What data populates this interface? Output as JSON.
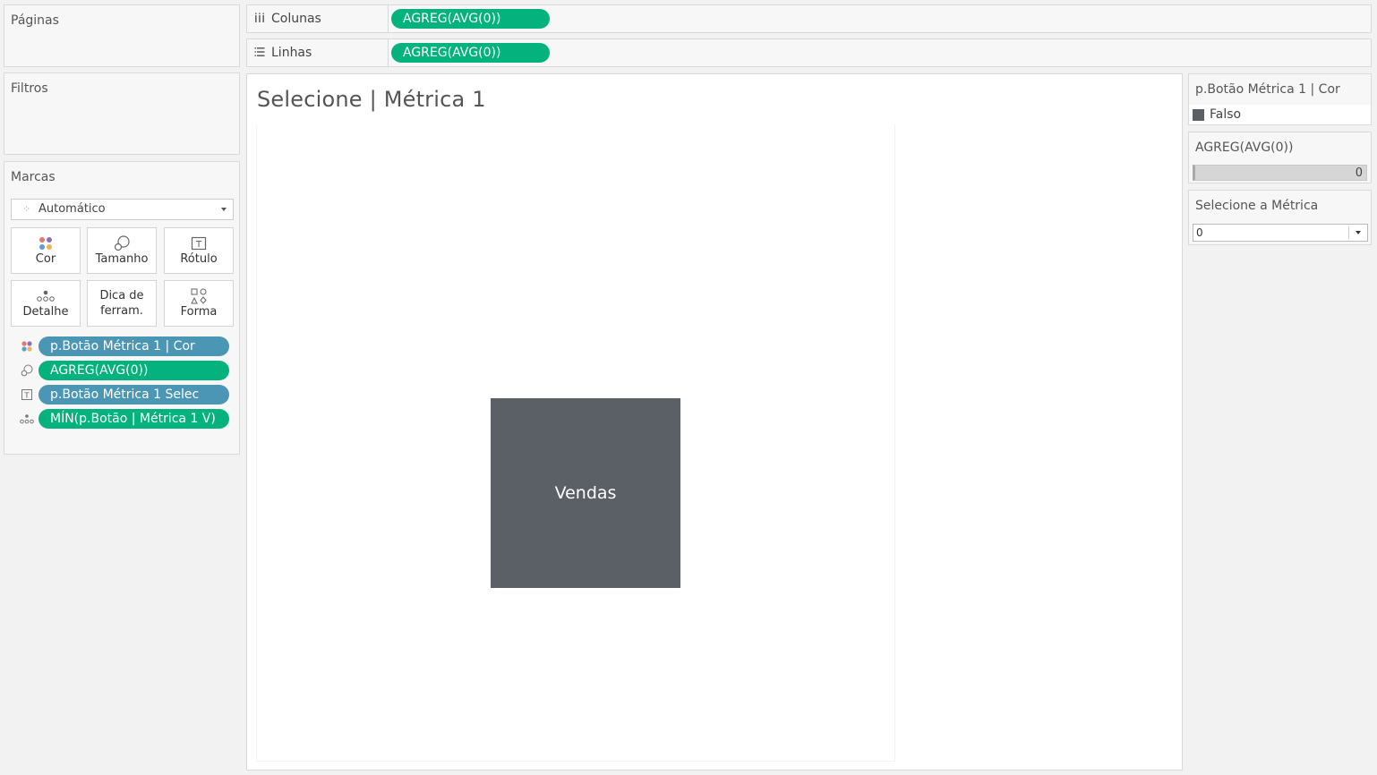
{
  "panels": {
    "pages_title": "Páginas",
    "filters_title": "Filtros",
    "marks_title": "Marcas"
  },
  "shelves": {
    "columns": {
      "label": "Colunas",
      "icon": "columns-icon",
      "pill": "AGREG(AVG(0))"
    },
    "rows": {
      "label": "Linhas",
      "icon": "rows-icon",
      "pill": "AGREG(AVG(0))"
    }
  },
  "marks": {
    "type": "Automático",
    "buttons": {
      "color": "Cor",
      "size": "Tamanho",
      "label": "Rótulo",
      "detail": "Detalhe",
      "tooltip": "Dica de ferram.",
      "shape": "Forma"
    },
    "fields": [
      {
        "icon": "color-dots-icon",
        "label": "p.Botão Métrica 1 | Cor",
        "type": "discrete"
      },
      {
        "icon": "size-icon",
        "label": "AGREG(AVG(0))",
        "type": "continuous"
      },
      {
        "icon": "text-label-icon",
        "label": "p.Botão Métrica 1 Selec",
        "type": "discrete"
      },
      {
        "icon": "detail-dots-icon",
        "label": "MÍN(p.Botão | Métrica 1 V)",
        "type": "continuous"
      }
    ]
  },
  "sheet": {
    "title": "Selecione | Métrica 1",
    "mark_label": "Vendas",
    "mark_color": "#5b5f66"
  },
  "legends": {
    "color_legend": {
      "title": "p.Botão Métrica 1 | Cor",
      "item": "Falso",
      "item_color": "#5b5f66"
    },
    "size_legend": {
      "title": "AGREG(AVG(0))",
      "value": "0"
    },
    "parameter": {
      "title": "Selecione a Métrica",
      "value": "0"
    }
  },
  "colors": {
    "pill_green": "#03b27c",
    "pill_blue": "#4b96b4"
  }
}
